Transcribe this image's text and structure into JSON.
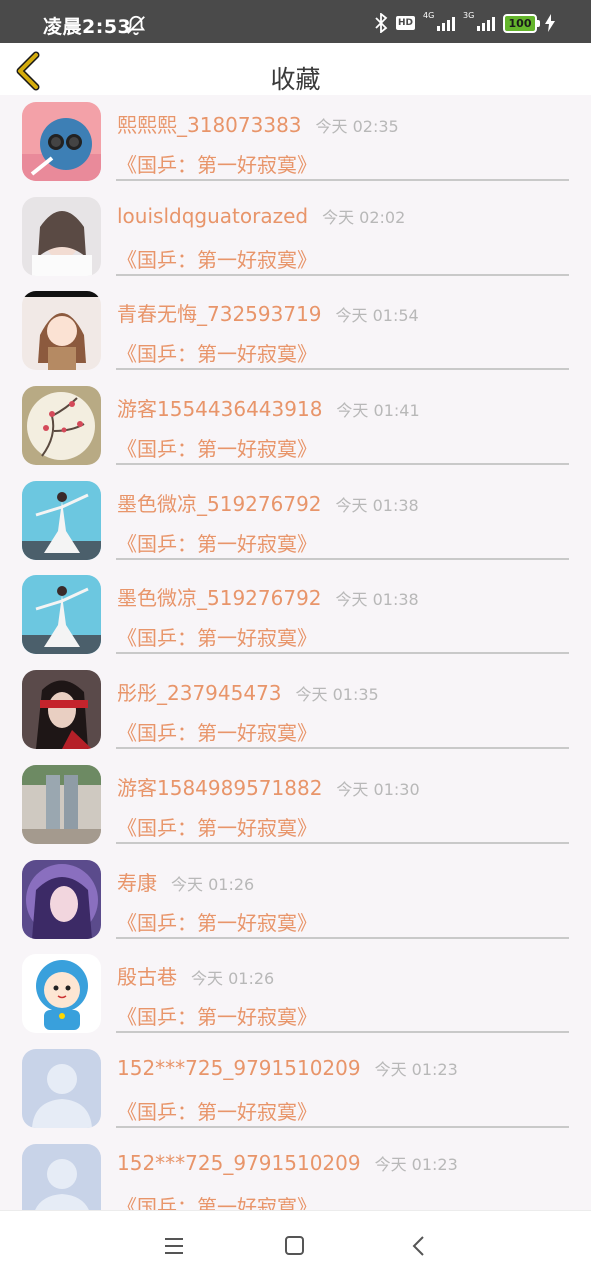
{
  "status_bar": {
    "time": "凌晨2:53",
    "hd": "HD",
    "net1": "4G",
    "net2": "3G",
    "battery": "100"
  },
  "header": {
    "title": "收藏"
  },
  "favorites": [
    {
      "user": "熙熙熙_318073383",
      "time": "今天 02:35",
      "title": "《国乒：第一好寂寞》",
      "avatar": "cartoon-cat"
    },
    {
      "user": "louisldqguatorazed",
      "time": "今天 02:02",
      "title": "《国乒：第一好寂寞》",
      "avatar": "girl-photo"
    },
    {
      "user": "青春无悔_732593719",
      "time": "今天 01:54",
      "title": "《国乒：第一好寂寞》",
      "avatar": "anime-girl"
    },
    {
      "user": "游客1554436443918",
      "time": "今天 01:41",
      "title": "《国乒：第一好寂寞》",
      "avatar": "plum-blossom"
    },
    {
      "user": "墨色微凉_519276792",
      "time": "今天 01:38",
      "title": "《国乒：第一好寂寞》",
      "avatar": "dancer-blue"
    },
    {
      "user": "墨色微凉_519276792",
      "time": "今天 01:38",
      "title": "《国乒：第一好寂寞》",
      "avatar": "dancer-blue"
    },
    {
      "user": "彤彤_237945473",
      "time": "今天 01:35",
      "title": "《国乒：第一好寂寞》",
      "avatar": "red-blindfold"
    },
    {
      "user": "游客1584989571882",
      "time": "今天 01:30",
      "title": "《国乒：第一好寂寞》",
      "avatar": "legs-photo"
    },
    {
      "user": "寿康",
      "time": "今天 01:26",
      "title": "《国乒：第一好寂寞》",
      "avatar": "purple-girl"
    },
    {
      "user": "殷古巷",
      "time": "今天 01:26",
      "title": "《国乒：第一好寂寞》",
      "avatar": "doraemon-kid"
    },
    {
      "user": "152***725_9791510209",
      "time": "今天 01:23",
      "title": "《国乒：第一好寂寞》",
      "avatar": "default-person"
    },
    {
      "user": "152***725_9791510209",
      "time": "今天 01:23",
      "title": "《国乒：第一好寂寞》",
      "avatar": "default-person"
    }
  ],
  "nav": {
    "icons": [
      "menu-icon",
      "home-icon",
      "back-icon"
    ]
  },
  "colors": {
    "accent": "#e8956a",
    "time_gray": "#b8b8b8",
    "status_bg": "#4a4a4a",
    "back_arrow": "#d4ac0d"
  }
}
